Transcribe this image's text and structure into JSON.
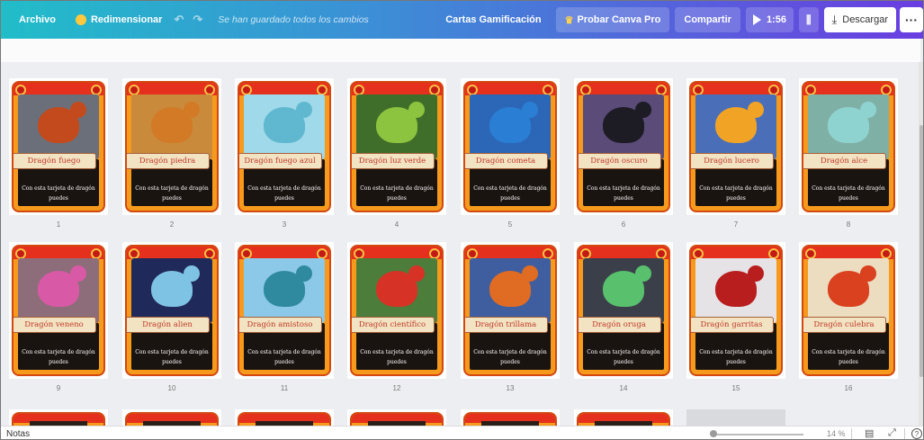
{
  "toolbar": {
    "file_label": "Archivo",
    "resize_label": "Redimensionar",
    "undo_icon": "↶",
    "redo_icon": "↷",
    "save_status": "Se han guardado todos los cambios",
    "design_title": "Cartas Gamificación",
    "pro_label": "Probar Canva Pro",
    "share_label": "Compartir",
    "present_label": "1:56",
    "stats_icon": "⫼",
    "download_label": "Descargar",
    "download_icon": "⤓",
    "more_icon": "···"
  },
  "card_text": "Con esta tarjeta de dragón puedes",
  "pages": [
    {
      "num": "1",
      "name": "Dragón fuego",
      "bg": "#6b6f7a",
      "dragon": "#c34a1c"
    },
    {
      "num": "2",
      "name": "Dragón piedra",
      "bg": "#c98b3b",
      "dragon": "#d27a26"
    },
    {
      "num": "3",
      "name": "Dragón fuego azul",
      "bg": "#9fd9ea",
      "dragon": "#5fb8cf"
    },
    {
      "num": "4",
      "name": "Dragón luz verde",
      "bg": "#3f6e2a",
      "dragon": "#8cc43f"
    },
    {
      "num": "5",
      "name": "Dragón cometa",
      "bg": "#2c66b6",
      "dragon": "#2a7fd4"
    },
    {
      "num": "6",
      "name": "Dragón oscuro",
      "bg": "#5a4b78",
      "dragon": "#1d1b24"
    },
    {
      "num": "7",
      "name": "Dragón lucero",
      "bg": "#4a6fb8",
      "dragon": "#f1a326"
    },
    {
      "num": "8",
      "name": "Dragón alce",
      "bg": "#7fb0a5",
      "dragon": "#8fd3d0"
    },
    {
      "num": "9",
      "name": "Dragón veneno",
      "bg": "#8e6d7a",
      "dragon": "#d859a6"
    },
    {
      "num": "10",
      "name": "Dragón alien",
      "bg": "#1f2a5a",
      "dragon": "#7fc3e4"
    },
    {
      "num": "11",
      "name": "Dragón amistoso",
      "bg": "#8cc8e8",
      "dragon": "#2f8aa0"
    },
    {
      "num": "12",
      "name": "Dragón científico",
      "bg": "#4d7d3b",
      "dragon": "#d63226"
    },
    {
      "num": "13",
      "name": "Dragón trillama",
      "bg": "#3e5ea0",
      "dragon": "#e06b23"
    },
    {
      "num": "14",
      "name": "Dragón oruga",
      "bg": "#3a3f4a",
      "dragon": "#59c06e"
    },
    {
      "num": "15",
      "name": "Dragón garritas",
      "bg": "#e6e3e6",
      "dragon": "#b81e1e"
    },
    {
      "num": "16",
      "name": "Dragón culebra",
      "bg": "#ecdcc0",
      "dragon": "#d9411f"
    }
  ],
  "bottombar": {
    "notes_label": "Notas",
    "zoom_label": "14 %",
    "zoom_level": 0.14,
    "grid_icon": "▤",
    "fullscreen_icon": "⤢",
    "help_icon": "?"
  }
}
